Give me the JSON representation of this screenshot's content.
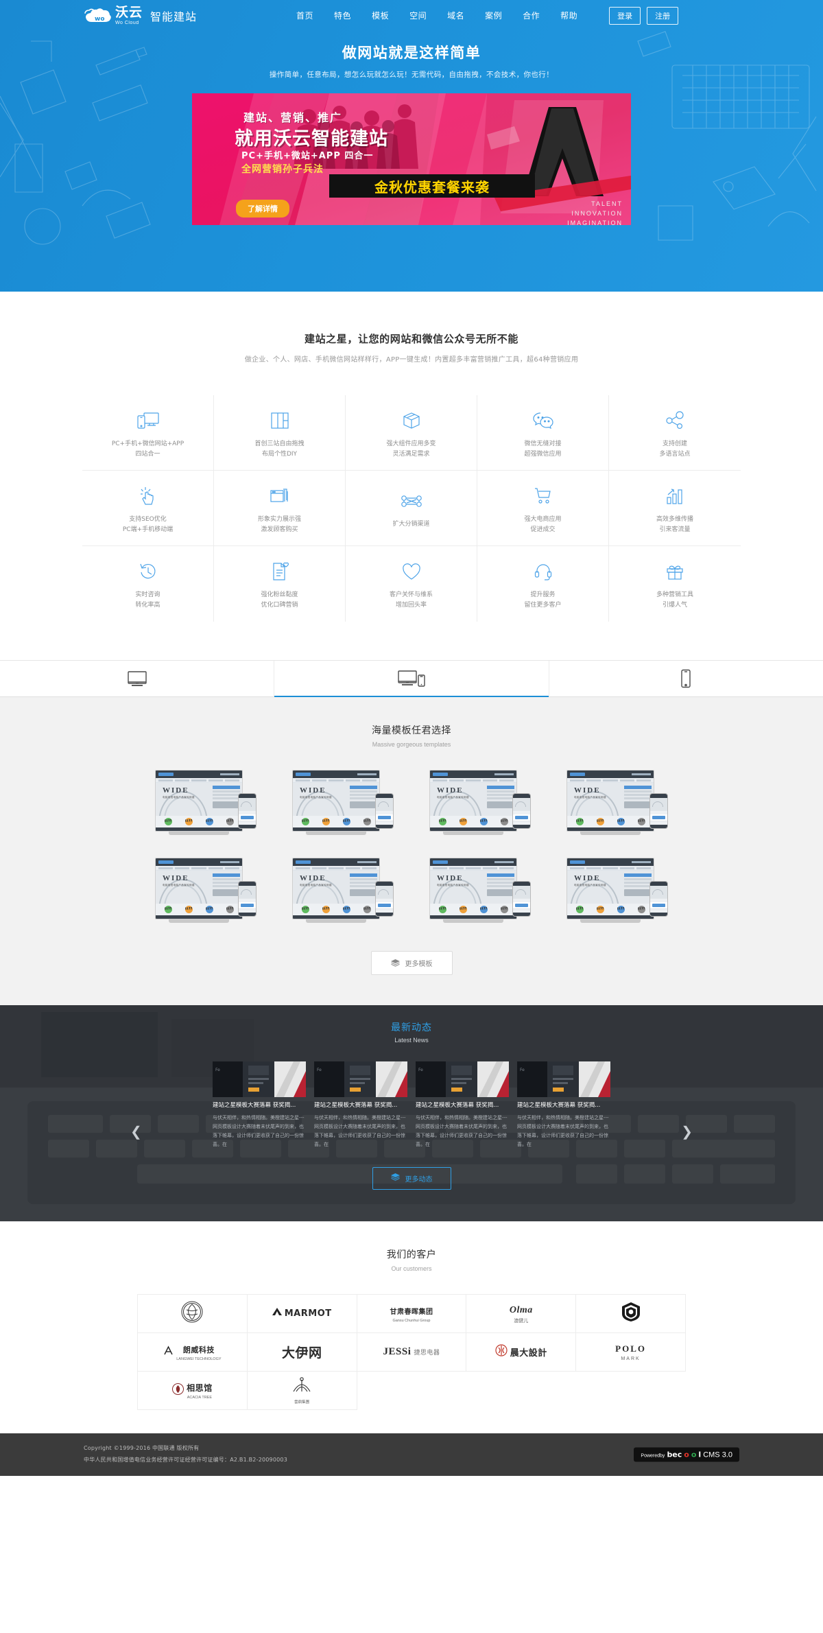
{
  "header": {
    "brand_zh": "沃云",
    "brand_en": "Wo Cloud",
    "brand_sub": "智能建站",
    "nav": [
      {
        "label": "首页"
      },
      {
        "label": "特色"
      },
      {
        "label": "模板"
      },
      {
        "label": "空间"
      },
      {
        "label": "域名"
      },
      {
        "label": "案例"
      },
      {
        "label": "合作"
      },
      {
        "label": "帮助"
      }
    ],
    "login_label": "登录",
    "register_label": "注册"
  },
  "hero": {
    "title": "做网站就是这样简单",
    "subtitle": "操作简单，任意布局，想怎么玩就怎么玩！无需代码，自由拖拽，不会技术，你也行！",
    "banner": {
      "line1": "建站、营销、推广",
      "line2": "就用沃云智能建站",
      "line3": "PC+手机+微站+APP 四合一",
      "line4": "全网营销孙子兵法",
      "highlight": "金秋优惠套餐来袭",
      "cta": "了解详情",
      "eng1": "TALENT",
      "eng2": "INNOVATION",
      "eng3": "IMAGINATION"
    }
  },
  "features": {
    "title": "建站之星，让您的网站和微信公众号无所不能",
    "subtitle": "做企业、个人、网店、手机微信网站样样行，APP一键生成！内置超多丰富营销推广工具，超64种营销应用",
    "items": [
      {
        "icon": "devices-icon",
        "line1": "PC+手机+微信网站+APP",
        "line2": "四站合一"
      },
      {
        "icon": "layout-icon",
        "line1": "首创三站自由拖拽",
        "line2": "布局个性DIY"
      },
      {
        "icon": "box-icon",
        "line1": "强大组件应用多变",
        "line2": "灵活满足需求"
      },
      {
        "icon": "wechat-icon",
        "line1": "微信无缝对接",
        "line2": "超强微信应用"
      },
      {
        "icon": "share-icon",
        "line1": "支持创建",
        "line2": "多语言站点"
      },
      {
        "icon": "click-icon",
        "line1": "支持SEO优化",
        "line2": "PC端+手机移动端"
      },
      {
        "icon": "windows-icon",
        "line1": "形象实力展示强",
        "line2": "激发顾客购买"
      },
      {
        "icon": "network-icon",
        "line1": "扩大分销渠道",
        "line2": ""
      },
      {
        "icon": "cart-icon",
        "line1": "强大电商应用",
        "line2": "促进成交"
      },
      {
        "icon": "chart-icon",
        "line1": "高效多维传播",
        "line2": "引来客流量"
      },
      {
        "icon": "clock-icon",
        "line1": "实时咨询",
        "line2": "转化率高"
      },
      {
        "icon": "document-icon",
        "line1": "强化粉丝黏度",
        "line2": "优化口碑营销"
      },
      {
        "icon": "heart-icon",
        "line1": "客户关怀与维系",
        "line2": "增加回头率"
      },
      {
        "icon": "headset-icon",
        "line1": "提升服务",
        "line2": "留住更多客户"
      },
      {
        "icon": "gift-icon",
        "line1": "多种营销工具",
        "line2": "引爆人气"
      }
    ]
  },
  "device_tabs": [
    {
      "icon": "desktop-icon",
      "name": "desktop",
      "active": false
    },
    {
      "icon": "desktop-mobile-icon",
      "name": "responsive",
      "active": true
    },
    {
      "icon": "mobile-icon",
      "name": "mobile",
      "active": false
    }
  ],
  "templates": {
    "title": "海量模板任君选择",
    "subtitle": "Massive gorgeous templates",
    "more_label": "更多模板",
    "cards": [
      {
        "brand": "WIDE",
        "caption": "电脑电视电脑产品宣传网建"
      },
      {
        "brand": "WIDE",
        "caption": "电脑电视电脑产品宣传网建"
      },
      {
        "brand": "WIDE",
        "caption": "电脑电视电脑产品宣传网建"
      },
      {
        "brand": "WIDE",
        "caption": "电脑电视电脑产品宣传网建"
      },
      {
        "brand": "WIDE",
        "caption": "电脑电视电脑产品宣传网建"
      },
      {
        "brand": "WIDE",
        "caption": "电脑电视电脑产品宣传网建"
      },
      {
        "brand": "WIDE",
        "caption": "电脑电视电脑产品宣传网建"
      },
      {
        "brand": "WIDE",
        "caption": "电脑电视电脑产品宣传网建"
      }
    ]
  },
  "news": {
    "title": "最新动态",
    "title_en": "Latest News",
    "more_label": "更多动态",
    "prev_icon": "chevron-left-icon",
    "next_icon": "chevron-right-icon",
    "items": [
      {
        "title": "建站之星模板大赛落幕 获奖揭...",
        "excerpt": "与伏天相伴，和热情相随。美橙建站之星---网页模板设计大赛随着末伏尾声的到来，也落下帷幕，设计师们更收获了自己的一份惊喜。在"
      },
      {
        "title": "建站之星模板大赛落幕 获奖揭...",
        "excerpt": "与伏天相伴，和热情相随。美橙建站之星---网页模板设计大赛随着末伏尾声的到来，也落下帷幕，设计师们更收获了自己的一份惊喜。在"
      },
      {
        "title": "建站之星模板大赛落幕 获奖揭...",
        "excerpt": "与伏天相伴，和热情相随。美橙建站之星---网页模板设计大赛随着末伏尾声的到来，也落下帷幕，设计师们更收获了自己的一份惊喜。在"
      },
      {
        "title": "建站之星模板大赛落幕 获奖揭...",
        "excerpt": "与伏天相伴，和热情相随。美橙建站之星---网页模板设计大赛随着末伏尾声的到来，也落下帷幕，设计师们更收获了自己的一份惊喜。在"
      }
    ]
  },
  "customers": {
    "title": "我们的客户",
    "subtitle": "Our customers",
    "logos": [
      {
        "name": "crest-logo",
        "text": "",
        "sub": ""
      },
      {
        "name": "marmot-logo",
        "text": "MARMOT",
        "sub": ""
      },
      {
        "name": "ganshu-chunhui-logo",
        "text": "甘肃春晖集团",
        "sub": "Gansu Chunhui Group"
      },
      {
        "name": "olma-logo",
        "text": "Olma",
        "sub": "澳健儿"
      },
      {
        "name": "badge-logo",
        "text": "",
        "sub": ""
      },
      {
        "name": "langwei-logo",
        "text": "朗威科技",
        "sub": "LANGWEI TECHNOLOGY"
      },
      {
        "name": "dayiwang-logo",
        "text": "大伊网",
        "sub": ""
      },
      {
        "name": "jessi-logo",
        "text": "JESSi",
        "sub": "捷思电器"
      },
      {
        "name": "chendashe-logo",
        "text": "晨大設計",
        "sub": ""
      },
      {
        "name": "polo-logo",
        "text": "POLO",
        "sub": "MARK"
      },
      {
        "name": "xiangsiguan-logo",
        "text": "相思馆",
        "sub": "ACACIA TREE"
      },
      {
        "name": "seal-logo",
        "text": "",
        "sub": "雲鼎集團"
      }
    ]
  },
  "footer": {
    "copyright": "Copyright ©1999-2016 中国联通 版权所有",
    "license": "中华人民共和国增值电信业务经营许可证经营许可证编号：A2.B1.B2-20090003",
    "powered_by": "Poweredby",
    "powered_brand_1": "bec",
    "powered_brand_o1": "o",
    "powered_brand_o2": "o",
    "powered_brand_2": "l",
    "powered_cms": "CMS 3.0"
  }
}
